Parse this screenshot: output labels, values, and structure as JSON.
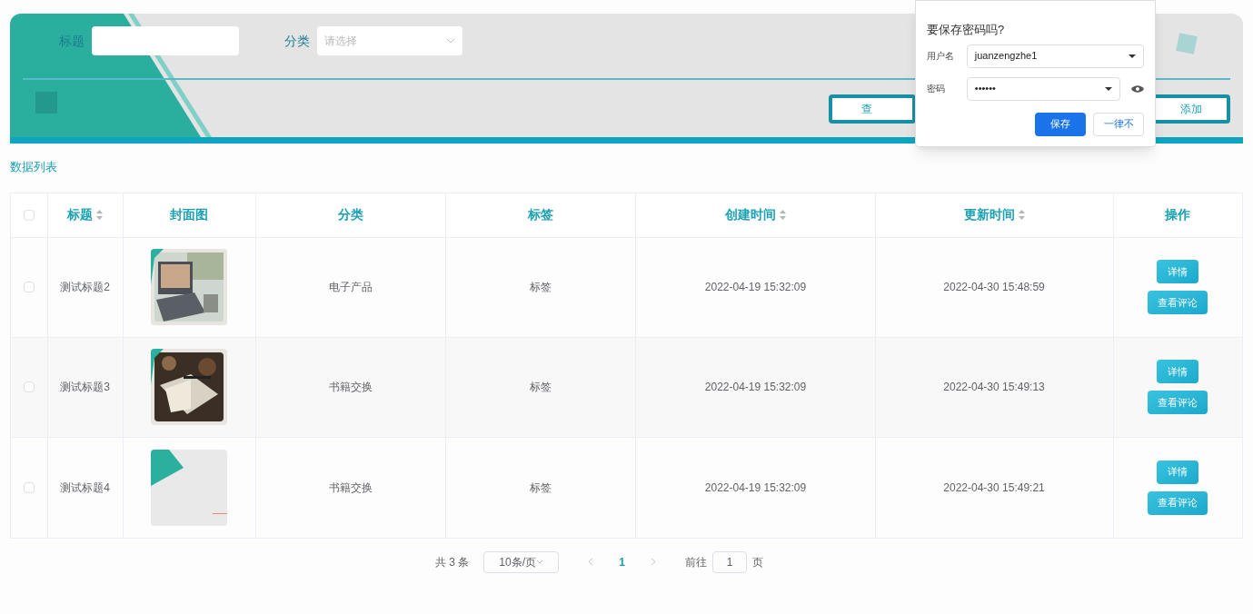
{
  "search": {
    "title_label": "标题",
    "category_label": "分类",
    "category_placeholder": "请选择",
    "buttons": [
      "查",
      "添加"
    ]
  },
  "password_popup": {
    "title": "要保存密码吗?",
    "username_label": "用户名",
    "username": "juanzengzhe1",
    "password_label": "密码",
    "password": "••••••",
    "save": "保存",
    "never": "一律不"
  },
  "section_title": "数据列表",
  "table": {
    "select_all": {
      "checked": false
    },
    "columns": [
      {
        "label": "标题",
        "sortable": true
      },
      {
        "label": "封面图",
        "sortable": false
      },
      {
        "label": "分类",
        "sortable": false
      },
      {
        "label": "标签",
        "sortable": false
      },
      {
        "label": "创建时间",
        "sortable": true
      },
      {
        "label": "更新时间",
        "sortable": true
      },
      {
        "label": "操作",
        "sortable": false
      }
    ],
    "rows": [
      {
        "checked": false,
        "title": "测试标题2",
        "category": "电子产品",
        "tag": "标签",
        "created": "2022-04-19 15:32:09",
        "updated": "2022-04-30 15:48:59",
        "actions": [
          "详情",
          "查看评论"
        ]
      },
      {
        "checked": false,
        "title": "测试标题3",
        "category": "书籍交换",
        "tag": "标签",
        "created": "2022-04-19 15:32:09",
        "updated": "2022-04-30 15:49:13",
        "actions": [
          "详情",
          "查看评论"
        ]
      },
      {
        "checked": false,
        "title": "测试标题4",
        "category": "书籍交换",
        "tag": "标签",
        "created": "2022-04-19 15:32:09",
        "updated": "2022-04-30 15:49:21",
        "actions": [
          "详情",
          "查看评论"
        ]
      }
    ]
  },
  "pagination": {
    "total": "共 3 条",
    "page_size": "10条/页",
    "pages": [
      {
        "label": "1",
        "selected": true
      }
    ],
    "goto_label": "前往",
    "goto_value": "1",
    "page_unit": "页"
  }
}
